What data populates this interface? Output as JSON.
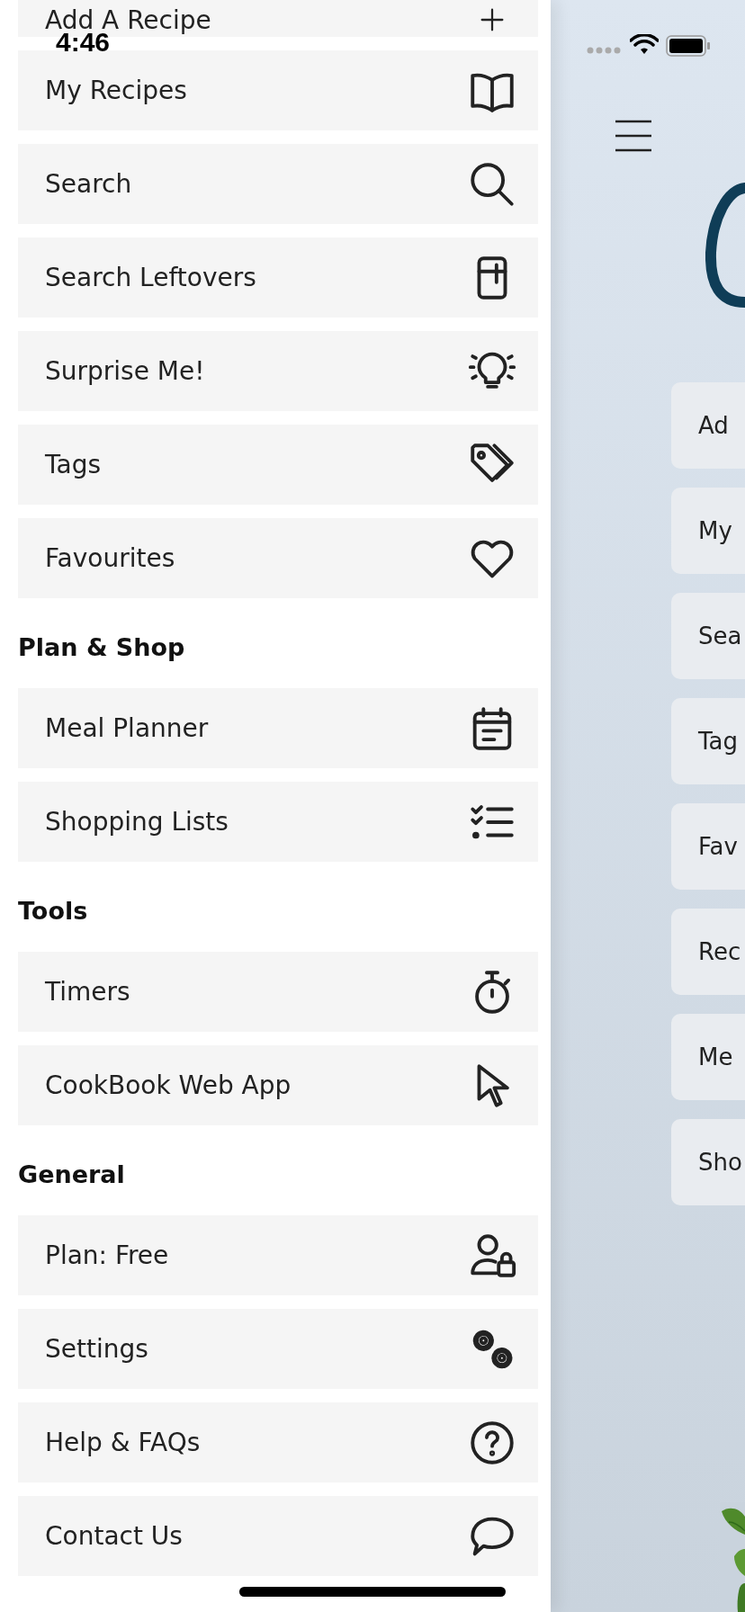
{
  "status_bar": {
    "time": "4:46"
  },
  "drawer": {
    "sections": [
      {
        "items": [
          "Add A Recipe",
          "My Recipes",
          "Search",
          "Search Leftovers",
          "Surprise Me!",
          "Tags",
          "Favourites"
        ]
      },
      {
        "title": "Plan & Shop",
        "items": [
          "Meal Planner",
          "Shopping Lists"
        ]
      },
      {
        "title": "Tools",
        "items": [
          "Timers",
          "CookBook Web App"
        ]
      },
      {
        "title": "General",
        "items": [
          "Plan: Free",
          "Settings",
          "Help & FAQs",
          "Contact Us"
        ]
      }
    ]
  },
  "background_page": {
    "menu_buttons": [
      "Ad",
      "My",
      "Sea",
      "Tag",
      "Fav",
      "Rec",
      "Me",
      "Sho"
    ]
  }
}
